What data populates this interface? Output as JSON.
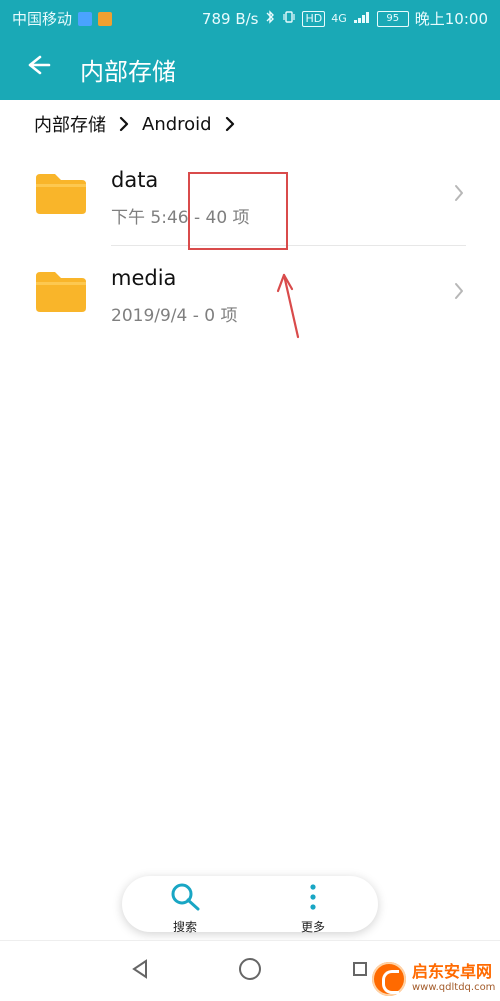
{
  "status_bar": {
    "carrier": "中国移动",
    "net_speed": "789 B/s",
    "hd_badge": "HD",
    "network": "4G",
    "battery": "95",
    "time": "晚上10:00"
  },
  "app_bar": {
    "title": "内部存储"
  },
  "breadcrumb": {
    "items": [
      "内部存储",
      "Android"
    ]
  },
  "list": {
    "items": [
      {
        "name": "data",
        "meta": "下午 5:46 - 40 项"
      },
      {
        "name": "media",
        "meta": "2019/9/4 - 0 项"
      }
    ]
  },
  "toolbar": {
    "search_label": "搜索",
    "more_label": "更多"
  },
  "watermark": {
    "title": "启东安卓网",
    "url": "www.qdltdq.com"
  },
  "colors": {
    "primary": "#1aa9b6",
    "folder": "#f9b52a",
    "annotation": "#d94b4b",
    "accent": "#19a6c4"
  },
  "icons": {
    "back": "arrow-left-icon",
    "breadcrumb_chevron": "chevron-right-icon",
    "folder": "folder-icon",
    "row_chevron": "chevron-right-icon",
    "search": "search-icon",
    "more": "more-vertical-icon",
    "nav_back": "triangle-back-icon",
    "nav_home": "circle-home-icon",
    "nav_recent": "square-recent-icon"
  }
}
